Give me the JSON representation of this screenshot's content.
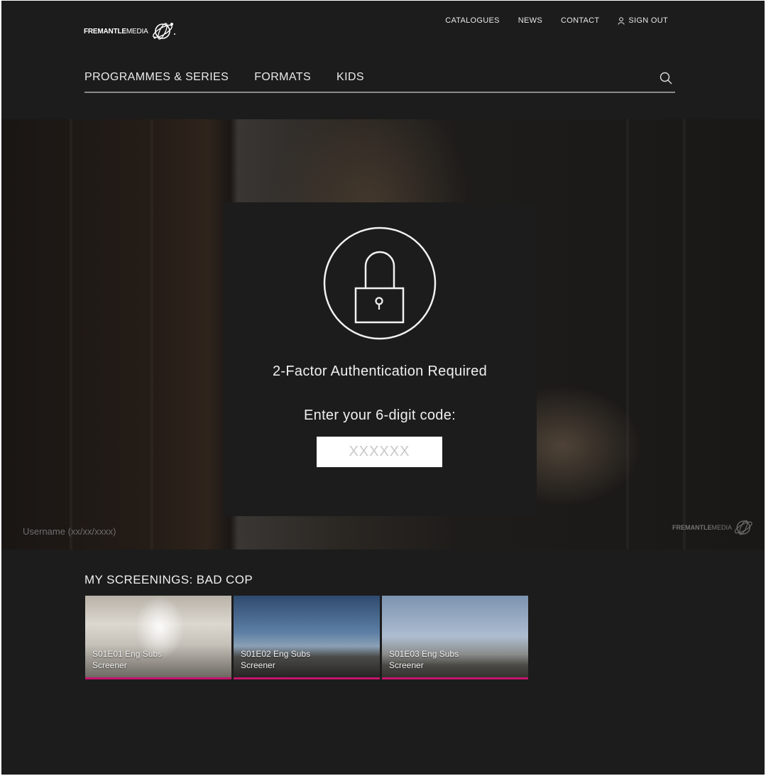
{
  "header": {
    "logo_bold": "FREMANTLE",
    "logo_light": "MEDIA",
    "top_nav": [
      "CATALOGUES",
      "NEWS",
      "CONTACT"
    ],
    "sign_out": "SIGN OUT",
    "main_nav": [
      "PROGRAMMES & SERIES",
      "FORMATS",
      "KIDS"
    ]
  },
  "hero": {
    "watermark_user": "Username (xx/xx/xxxx)",
    "watermark_logo_bold": "FREMANTLE",
    "watermark_logo_light": "MEDIA"
  },
  "auth_modal": {
    "title": "2-Factor Authentication Required",
    "prompt": "Enter your 6-digit code:",
    "code_placeholder": "XXXXXX"
  },
  "screenings": {
    "title": "MY SCREENINGS: BAD COP",
    "items": [
      {
        "line1": "S01E01 Eng Subs",
        "line2": "Screener"
      },
      {
        "line1": "S01E02 Eng Subs",
        "line2": "Screener"
      },
      {
        "line1": "S01E03 Eng Subs",
        "line2": "Screener"
      }
    ]
  },
  "colors": {
    "background": "#1c1c1c",
    "accent_underline": "#c4146b",
    "input_background": "#ffffff"
  },
  "icons": [
    "globe-logo-icon",
    "user-icon",
    "search-icon",
    "lock-icon"
  ]
}
